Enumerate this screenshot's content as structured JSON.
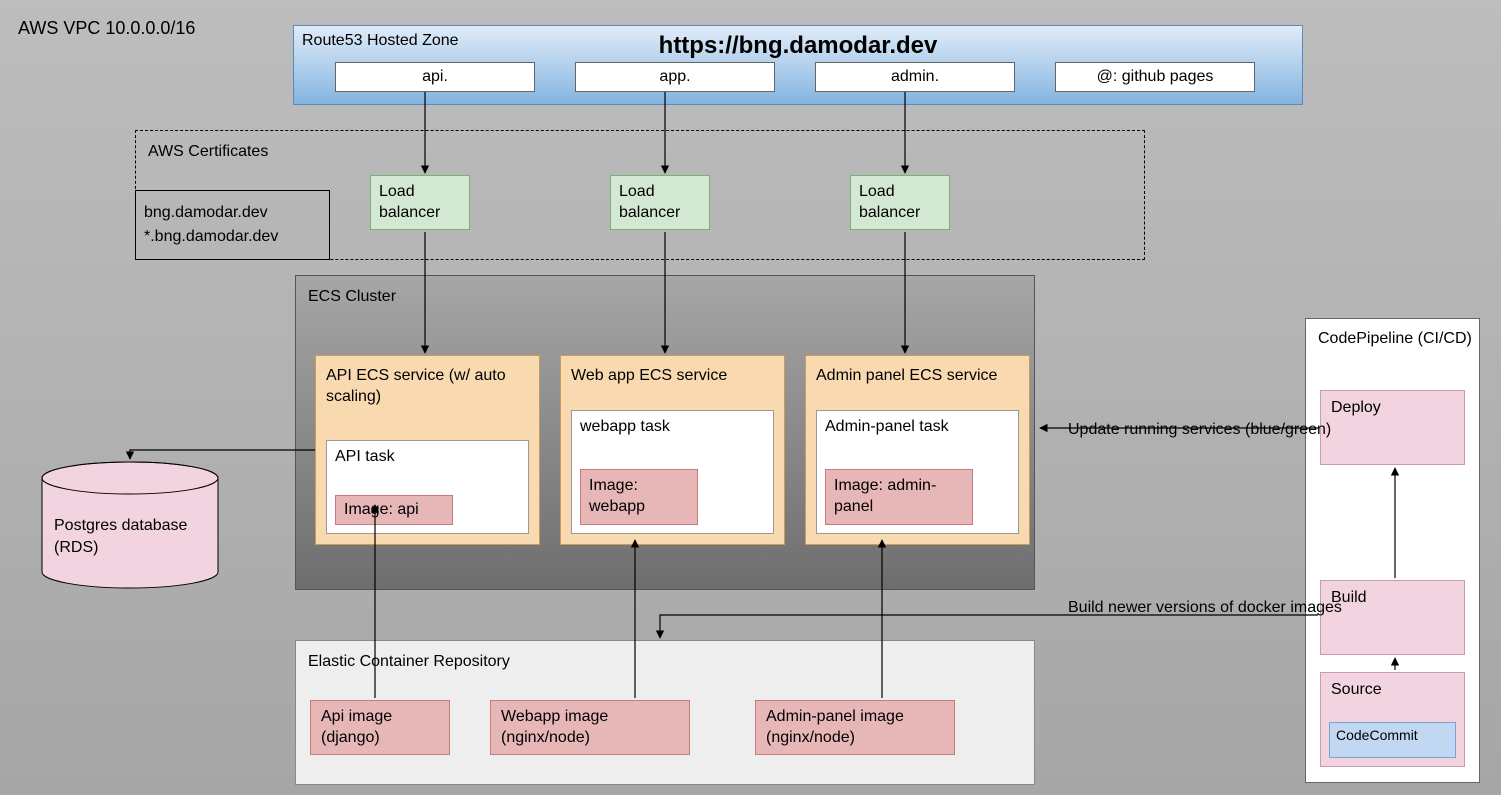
{
  "vpc_label": "AWS VPC 10.0.0.0/16",
  "route53": {
    "title": "Route53 Hosted Zone",
    "url": "https://bng.damodar.dev",
    "records": {
      "api": "api.",
      "app": "app.",
      "admin": "admin.",
      "root": "@: github pages"
    }
  },
  "certs": {
    "title": "AWS Certificates",
    "line1": "bng.damodar.dev",
    "line2": "*.bng.damodar.dev"
  },
  "lb_label": "Load balancer",
  "ecs": {
    "title": "ECS Cluster",
    "api": {
      "title": "API ECS service (w/ auto scaling)",
      "task": "API task",
      "image": "Image: api"
    },
    "webapp": {
      "title": "Web app ECS service",
      "task": "webapp task",
      "image": "Image: webapp"
    },
    "admin": {
      "title": "Admin panel ECS service",
      "task": "Admin-panel task",
      "image": "Image: admin-panel"
    }
  },
  "rds": {
    "line1": "Postgres database",
    "line2": "(RDS)"
  },
  "ecr": {
    "title": "Elastic Container Repository",
    "api": "Api image (django)",
    "webapp": "Webapp image (nginx/node)",
    "admin": "Admin-panel image (nginx/node)"
  },
  "pipeline": {
    "title": "CodePipeline (CI/CD)",
    "deploy": "Deploy",
    "build": "Build",
    "source": "Source",
    "codecommit": "CodeCommit"
  },
  "edge_labels": {
    "update": "Update running services (blue/green)",
    "buildimg": "Build newer versions of docker images"
  }
}
